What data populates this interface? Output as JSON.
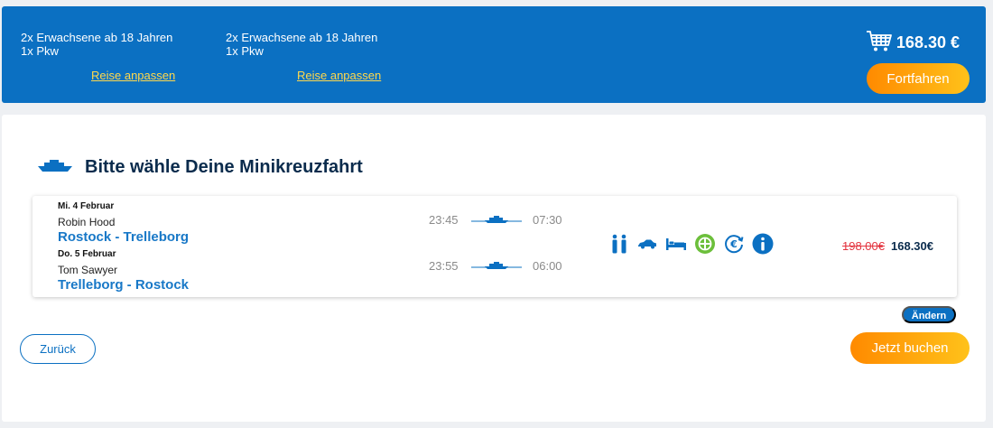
{
  "header": {
    "passengers": [
      {
        "adults": "2x Erwachsene ab 18 Jahren",
        "vehicle": "1x Pkw",
        "adjust_link": "Reise anpassen"
      },
      {
        "adults": "2x Erwachsene ab 18 Jahren",
        "vehicle": "1x Pkw",
        "adjust_link": "Reise anpassen"
      }
    ],
    "cart": {
      "icon": "shopping-cart-icon",
      "total": "168.30 €"
    },
    "continue_button": "Fortfahren"
  },
  "main": {
    "title": "Bitte wähle Deine Minikreuzfahrt",
    "title_icon": "ferry-icon",
    "trip": {
      "legs": [
        {
          "date": "Mi. 4 Februar",
          "ship": "Robin Hood",
          "route": "Rostock - Trelleborg",
          "departure": "23:45",
          "arrival": "07:30"
        },
        {
          "date": "Do. 5 Februar",
          "ship": "Tom Sawyer",
          "route": "Trelleborg - Rostock",
          "departure": "23:55",
          "arrival": "06:00"
        }
      ],
      "amenities": [
        "passengers-icon",
        "car-icon",
        "bed-icon",
        "meal-icon",
        "euro-refund-icon",
        "info-icon"
      ],
      "old_price": "198.00€",
      "price": "168.30€"
    },
    "change_badge": "Ändern",
    "back_button": "Zurück",
    "book_button": "Jetzt buchen"
  },
  "colors": {
    "brand_blue": "#0b70c2",
    "link_yellow": "#ffd84d",
    "accent_orange": "#ff8a00",
    "old_price_red": "#e3343f",
    "meal_green": "#6cbf3b"
  }
}
